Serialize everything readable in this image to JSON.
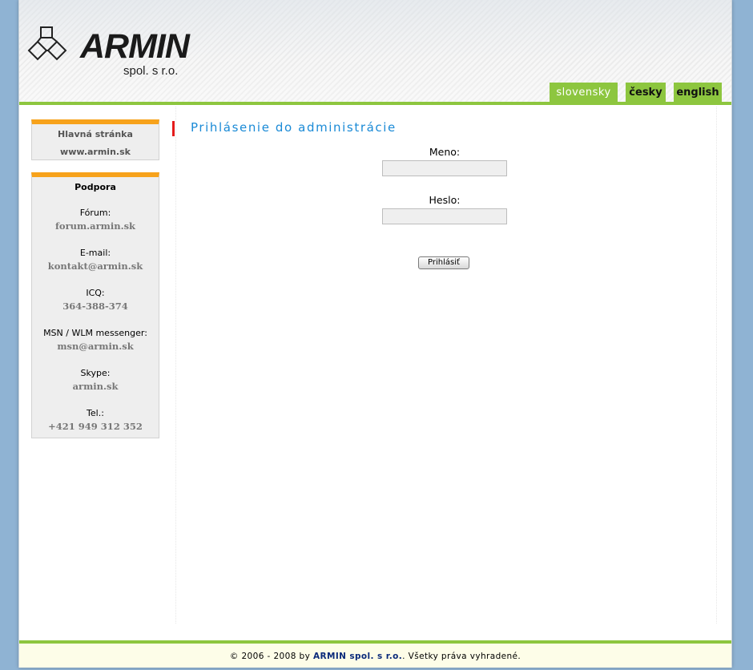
{
  "header": {
    "logo_word": "ARMIN",
    "logo_sub": "spol. s r.o.",
    "languages": [
      "slovensky",
      "česky",
      "english"
    ]
  },
  "sidebar": {
    "nav": [
      "Hlavná stránka",
      "www.armin.sk"
    ],
    "support": {
      "title": "Podpora",
      "items": [
        {
          "label": "Fórum:",
          "value": "forum.armin.sk"
        },
        {
          "label": "E-mail:",
          "value": "kontakt@armin.sk"
        },
        {
          "label": "ICQ:",
          "value": "364-388-374"
        },
        {
          "label": "MSN / WLM messenger:",
          "value": "msn@armin.sk"
        },
        {
          "label": "Skype:",
          "value": "armin.sk"
        },
        {
          "label": "Tel.:",
          "value": "+421 949 312 352"
        }
      ]
    }
  },
  "main": {
    "title": "Prihlásenie do administrácie",
    "username_label": "Meno:",
    "username_value": "",
    "password_label": "Heslo:",
    "password_value": "",
    "login_button": "Prihlásiť"
  },
  "footer": {
    "prefix": "© 2006 - 2008 by",
    "company": "ARMIN spol. s r.o.",
    "suffix": ". Všetky práva vyhradené."
  },
  "colors": {
    "accent_green": "#8dc63f",
    "accent_orange": "#f7a21b",
    "title_blue": "#1a8ad6",
    "title_marker_red": "#e41b1b",
    "background_blue": "#8fb3d3"
  }
}
